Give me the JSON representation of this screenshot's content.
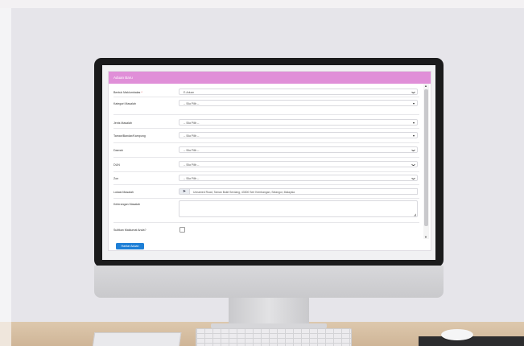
{
  "form": {
    "header_title": "Aduan Baru",
    "fields": [
      {
        "label": "Bentuk Maklumbalas",
        "required_mark": "*",
        "value": "E-Aduan",
        "chevron": "❯"
      },
      {
        "label": "Kategori Masalah",
        "value": "-- Sila Pilih --",
        "chevron": "▾"
      },
      {
        "label": "Jenis Masalah",
        "value": "-- Sila Pilih --",
        "chevron": "▾"
      },
      {
        "label": "Taman/Bandar/Kampung",
        "value": "-- Sila Pilih --",
        "chevron": "▾"
      },
      {
        "label": "Daerah",
        "value": "-- Sila Pilih --",
        "chevron": "❯"
      },
      {
        "label": "DUN",
        "value": "-- Sila Pilih --",
        "chevron": "❯"
      },
      {
        "label": "Zon",
        "value": "-- Sila Pilih --",
        "chevron": "❯"
      }
    ],
    "location": {
      "label": "Lokasi Masalah",
      "value": "Unnamed Road, Taman Bukit Serdang, 43300 Seri Kembangan, Selangor, Malaysia"
    },
    "description": {
      "label": "Keterangan Masalah"
    },
    "confirm": {
      "label": "Sulitkan Maklumat Anda?"
    },
    "submit_label": "Hantar Aduan"
  },
  "icons": {
    "location": "location-arrow-icon",
    "resize": "resize-handle-icon"
  },
  "colors": {
    "header_bg": "#e08fd8",
    "submit_bg": "#1e7fd6",
    "required": "#d83a3a"
  }
}
